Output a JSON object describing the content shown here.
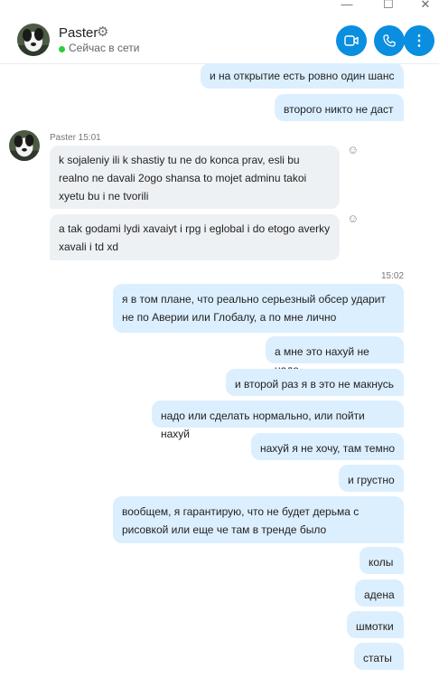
{
  "window": {
    "minimize": "—",
    "maximize": "☐",
    "close": "✕"
  },
  "contact": {
    "name": "Paster",
    "status": "Сейчас в сети",
    "settings_icon": "gear-icon"
  },
  "actions": {
    "video_icon": "video-camera-icon",
    "call_icon": "phone-icon",
    "more_icon": "more-icon"
  },
  "colors": {
    "accent": "#0a8ee0",
    "outgoing_bubble": "#dcefff",
    "incoming_bubble": "#eef1f4",
    "online": "#2ecc40"
  },
  "incoming_meta": "Paster 15:01",
  "time_divider": "15:02",
  "messages": [
    {
      "dir": "out",
      "text": "и на открытие есть ровно один шанс"
    },
    {
      "dir": "out",
      "text": "второго никто не даст"
    },
    {
      "dir": "in",
      "text": "k sojaleniy ili k shastiy tu ne do konca prav, esli bu realno ne davali 2ogo shansa to mojet adminu takoi xyetu bu i ne tvorili"
    },
    {
      "dir": "in",
      "text": "a tak godami lydi xavaiyt i rpg i eglobal i do etogo averky xavali i td xd"
    },
    {
      "dir": "out",
      "text": "я в том плане, что реально серьезный обсер ударит не по Аверии или Глобалу, а по мне лично"
    },
    {
      "dir": "out",
      "text": "а мне это нахуй не надо"
    },
    {
      "dir": "out",
      "text": "и второй раз я в это не макнусь"
    },
    {
      "dir": "out",
      "text": "надо или сделать нормально, или пойти нахуй"
    },
    {
      "dir": "out",
      "text": "нахуй я не хочу, там темно"
    },
    {
      "dir": "out",
      "text": "и грустно"
    },
    {
      "dir": "out",
      "text": "вообщем, я гарантирую, что не будет дерьма с рисовкой или еще че там в тренде было"
    },
    {
      "dir": "out",
      "text": "колы"
    },
    {
      "dir": "out",
      "text": "адена"
    },
    {
      "dir": "out",
      "text": "шмотки"
    },
    {
      "dir": "out",
      "text": "статы"
    }
  ]
}
